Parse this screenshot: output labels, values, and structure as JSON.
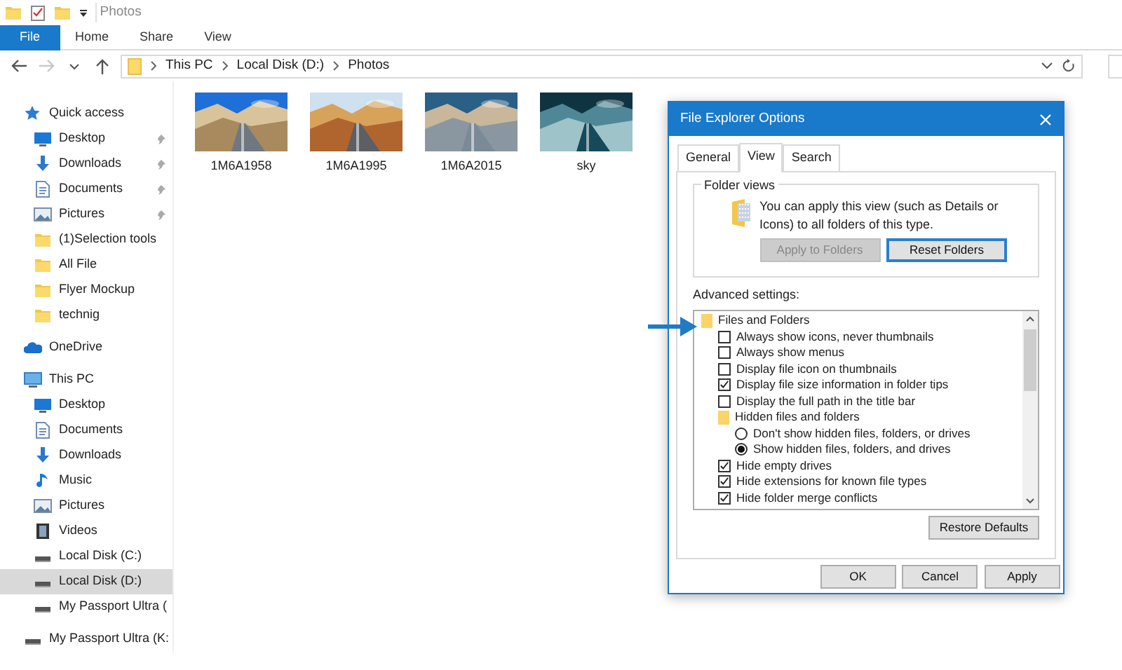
{
  "explorer": {
    "title": "Photos",
    "ribbon_tabs": [
      {
        "label": "File",
        "selected": true
      },
      {
        "label": "Home",
        "selected": false
      },
      {
        "label": "Share",
        "selected": false
      },
      {
        "label": "View",
        "selected": false
      }
    ],
    "nav_buttons": [
      {
        "kind": "back",
        "disabled": false
      },
      {
        "kind": "forward",
        "disabled": true
      },
      {
        "kind": "recent",
        "disabled": false
      },
      {
        "kind": "up",
        "disabled": false
      }
    ],
    "breadcrumb": [
      "This PC",
      "Local Disk (D:)",
      "Photos"
    ],
    "sidebar": {
      "items": [
        {
          "label": "Quick access",
          "kind": "quick",
          "selected": false,
          "children": [
            {
              "label": "Desktop",
              "kind": "desktop",
              "selected": false,
              "pinned": true
            },
            {
              "label": "Downloads",
              "kind": "downloads",
              "selected": false,
              "pinned": true
            },
            {
              "label": "Documents",
              "kind": "documents",
              "selected": false,
              "pinned": true
            },
            {
              "label": "Pictures",
              "kind": "pictures",
              "selected": false,
              "pinned": true
            },
            {
              "label": "(1)Selection tools",
              "kind": "folder",
              "selected": false,
              "pinned": false
            },
            {
              "label": "All File",
              "kind": "folder",
              "selected": false,
              "pinned": false
            },
            {
              "label": "Flyer Mockup",
              "kind": "folder",
              "selected": false,
              "pinned": false
            },
            {
              "label": "technig",
              "kind": "folder",
              "selected": false,
              "pinned": false
            }
          ]
        },
        {
          "label": "OneDrive",
          "kind": "onedrive",
          "selected": false
        },
        {
          "label": "This PC",
          "kind": "pc",
          "selected": false,
          "children": [
            {
              "label": "Desktop",
              "kind": "desktop",
              "selected": false
            },
            {
              "label": "Documents",
              "kind": "documents",
              "selected": false
            },
            {
              "label": "Downloads",
              "kind": "downloads",
              "selected": false
            },
            {
              "label": "Music",
              "kind": "music",
              "selected": false
            },
            {
              "label": "Pictures",
              "kind": "pictures",
              "selected": false
            },
            {
              "label": "Videos",
              "kind": "videos",
              "selected": false
            },
            {
              "label": "Local Disk (C:)",
              "kind": "drive",
              "selected": false
            },
            {
              "label": "Local Disk (D:)",
              "kind": "drive",
              "selected": true
            },
            {
              "label": "My Passport Ultra (",
              "kind": "drive",
              "selected": false
            }
          ]
        },
        {
          "label": "My Passport Ultra (K:",
          "kind": "drive",
          "selected": false
        }
      ]
    },
    "files": [
      {
        "name": "1M6A1958",
        "kind": "picture"
      },
      {
        "name": "1M6A1995",
        "kind": "picture"
      },
      {
        "name": "1M6A2015",
        "kind": "picture"
      },
      {
        "name": "sky",
        "kind": "picture"
      }
    ]
  },
  "dialog": {
    "title": "File Explorer Options",
    "tabs": [
      {
        "label": "General",
        "selected": false
      },
      {
        "label": "View",
        "selected": true
      },
      {
        "label": "Search",
        "selected": false
      }
    ],
    "folder_views": {
      "legend": "Folder views",
      "text": "You can apply this view (such as Details or Icons) to all folders of this type.",
      "buttons": [
        {
          "label": "Apply to Folders",
          "disabled": true,
          "default": false
        },
        {
          "label": "Reset Folders",
          "disabled": false,
          "default": true
        }
      ]
    },
    "advanced_label": "Advanced settings:",
    "settings": [
      {
        "kind": "folder",
        "label": "Files and Folders",
        "children": [
          {
            "kind": "checkbox",
            "label": "Always show icons, never thumbnails",
            "checked": false
          },
          {
            "kind": "checkbox",
            "label": "Always show menus",
            "checked": false
          },
          {
            "kind": "checkbox",
            "label": "Display file icon on thumbnails",
            "checked": false
          },
          {
            "kind": "checkbox",
            "label": "Display file size information in folder tips",
            "checked": true
          },
          {
            "kind": "checkbox",
            "label": "Display the full path in the title bar",
            "checked": false
          },
          {
            "kind": "folder",
            "label": "Hidden files and folders",
            "children": [
              {
                "kind": "radio",
                "label": "Don't show hidden files, folders, or drives",
                "checked": false
              },
              {
                "kind": "radio",
                "label": "Show hidden files, folders, and drives",
                "checked": true
              }
            ]
          },
          {
            "kind": "checkbox",
            "label": "Hide empty drives",
            "checked": true
          },
          {
            "kind": "checkbox",
            "label": "Hide extensions for known file types",
            "checked": true
          },
          {
            "kind": "checkbox",
            "label": "Hide folder merge conflicts",
            "checked": true
          }
        ]
      }
    ],
    "restore_button": "Restore Defaults",
    "buttons": [
      "OK",
      "Cancel",
      "Apply"
    ]
  }
}
